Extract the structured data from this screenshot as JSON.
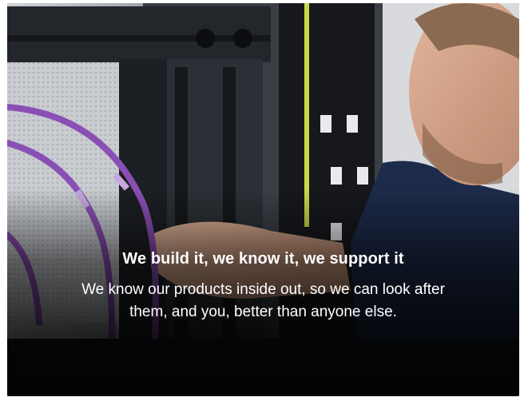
{
  "card": {
    "headline": "We build it, we know it, we support it",
    "body": "We know our products inside out, so we can look after them, and you, better than anyone else."
  },
  "image": {
    "subject": "technician-patching-server-rack",
    "cable_color": "#8a4fb5",
    "rack_color": "#1f2328",
    "shirt_color": "#1d2b4a"
  }
}
